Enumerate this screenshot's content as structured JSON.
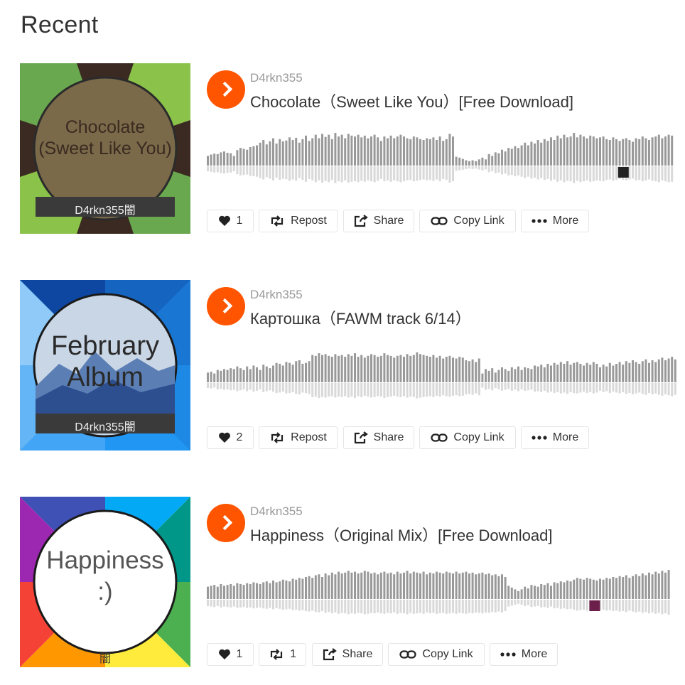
{
  "heading": "Recent",
  "colors": {
    "accent": "#ff5500",
    "wave": "#999999",
    "wave_reflection": "#d9d9d9"
  },
  "tracks": [
    {
      "artist": "D4rkn355",
      "title": "Chocolate（Sweet Like You）[Free Download]",
      "art": {
        "line1": "Chocolate",
        "line2": "(Sweet Like You)",
        "signature": "D4rkn355闇"
      },
      "actions": {
        "like_count": "1",
        "repost_label": "Repost",
        "share_label": "Share",
        "copy_link_label": "Copy Link",
        "more_label": "More"
      },
      "waveform": [
        0.22,
        0.25,
        0.27,
        0.26,
        0.3,
        0.32,
        0.29,
        0.28,
        0.22,
        0.35,
        0.4,
        0.38,
        0.36,
        0.42,
        0.44,
        0.46,
        0.52,
        0.58,
        0.48,
        0.55,
        0.62,
        0.5,
        0.6,
        0.55,
        0.57,
        0.64,
        0.58,
        0.63,
        0.52,
        0.6,
        0.68,
        0.56,
        0.62,
        0.7,
        0.62,
        0.72,
        0.65,
        0.7,
        0.6,
        0.74,
        0.66,
        0.7,
        0.62,
        0.72,
        0.68,
        0.66,
        0.7,
        0.64,
        0.68,
        0.62,
        0.66,
        0.7,
        0.64,
        0.56,
        0.66,
        0.62,
        0.68,
        0.62,
        0.66,
        0.7,
        0.66,
        0.62,
        0.6,
        0.66,
        0.64,
        0.6,
        0.58,
        0.62,
        0.6,
        0.64,
        0.58,
        0.66,
        0.56,
        0.6,
        0.72,
        0.66,
        0.2,
        0.18,
        0.15,
        0.12,
        0.1,
        0.12,
        0.1,
        0.14,
        0.18,
        0.14,
        0.26,
        0.22,
        0.3,
        0.28,
        0.36,
        0.32,
        0.4,
        0.38,
        0.44,
        0.4,
        0.46,
        0.52,
        0.46,
        0.54,
        0.5,
        0.58,
        0.52,
        0.6,
        0.56,
        0.64,
        0.58,
        0.68,
        0.62,
        0.7,
        0.64,
        0.66,
        0.74,
        0.64,
        0.7,
        0.66,
        0.62,
        0.68,
        0.66,
        0.62,
        0.64,
        0.66,
        0.6,
        0.58,
        0.64,
        0.6,
        0.56,
        0.6,
        0.62,
        0.58,
        0.54,
        0.62,
        0.6,
        0.66,
        0.62,
        0.58,
        0.64,
        0.66,
        0.7,
        0.62,
        0.66,
        0.7,
        0.68
      ],
      "thumb_color": "#222222",
      "thumb_at": 0.86
    },
    {
      "artist": "D4rkn355",
      "title": "Картошка（FAWM track 6/14）",
      "art": {
        "line1": "February",
        "line2": "Album",
        "signature": "D4rkn355闇"
      },
      "actions": {
        "like_count": "2",
        "repost_label": "Repost",
        "share_label": "Share",
        "copy_link_label": "Copy Link",
        "more_label": "More"
      },
      "waveform": [
        0.22,
        0.24,
        0.2,
        0.28,
        0.26,
        0.3,
        0.28,
        0.32,
        0.3,
        0.36,
        0.32,
        0.28,
        0.36,
        0.3,
        0.38,
        0.34,
        0.28,
        0.4,
        0.36,
        0.32,
        0.38,
        0.44,
        0.42,
        0.38,
        0.46,
        0.44,
        0.4,
        0.48,
        0.5,
        0.42,
        0.44,
        0.48,
        0.62,
        0.6,
        0.66,
        0.62,
        0.64,
        0.6,
        0.58,
        0.64,
        0.6,
        0.62,
        0.58,
        0.64,
        0.6,
        0.66,
        0.58,
        0.62,
        0.56,
        0.6,
        0.64,
        0.62,
        0.58,
        0.6,
        0.66,
        0.62,
        0.6,
        0.56,
        0.6,
        0.62,
        0.58,
        0.64,
        0.6,
        0.62,
        0.68,
        0.64,
        0.62,
        0.6,
        0.58,
        0.62,
        0.56,
        0.6,
        0.54,
        0.58,
        0.6,
        0.56,
        0.54,
        0.58,
        0.56,
        0.5,
        0.48,
        0.52,
        0.46,
        0.54,
        0.2,
        0.3,
        0.26,
        0.32,
        0.22,
        0.28,
        0.34,
        0.3,
        0.26,
        0.34,
        0.3,
        0.36,
        0.28,
        0.34,
        0.32,
        0.3,
        0.38,
        0.36,
        0.4,
        0.34,
        0.42,
        0.38,
        0.44,
        0.4,
        0.46,
        0.42,
        0.48,
        0.4,
        0.44,
        0.46,
        0.42,
        0.38,
        0.44,
        0.4,
        0.46,
        0.42,
        0.34,
        0.4,
        0.36,
        0.44,
        0.38,
        0.42,
        0.46,
        0.4,
        0.48,
        0.44,
        0.5,
        0.46,
        0.42,
        0.48,
        0.52,
        0.44,
        0.5,
        0.46,
        0.52,
        0.56,
        0.5,
        0.54,
        0.58,
        0.52
      ],
      "thumb_color": null,
      "thumb_at": null
    },
    {
      "artist": "D4rkn355",
      "title": "Happiness（Original Mix）[Free Download]",
      "art": {
        "line1": "Happiness",
        "line2": ":)",
        "signature": "闇"
      },
      "actions": {
        "like_count": "1",
        "repost_count": "1",
        "share_label": "Share",
        "copy_link_label": "Copy Link",
        "more_label": "More"
      },
      "waveform": [
        0.28,
        0.3,
        0.32,
        0.28,
        0.34,
        0.3,
        0.32,
        0.34,
        0.3,
        0.36,
        0.34,
        0.32,
        0.36,
        0.34,
        0.38,
        0.36,
        0.34,
        0.38,
        0.4,
        0.36,
        0.42,
        0.38,
        0.4,
        0.44,
        0.42,
        0.4,
        0.46,
        0.44,
        0.48,
        0.46,
        0.5,
        0.52,
        0.48,
        0.54,
        0.56,
        0.5,
        0.58,
        0.54,
        0.6,
        0.56,
        0.62,
        0.58,
        0.6,
        0.64,
        0.6,
        0.62,
        0.58,
        0.6,
        0.64,
        0.62,
        0.58,
        0.6,
        0.56,
        0.6,
        0.62,
        0.58,
        0.6,
        0.56,
        0.62,
        0.58,
        0.6,
        0.64,
        0.58,
        0.62,
        0.6,
        0.58,
        0.62,
        0.56,
        0.6,
        0.58,
        0.62,
        0.6,
        0.58,
        0.62,
        0.6,
        0.58,
        0.62,
        0.58,
        0.6,
        0.62,
        0.58,
        0.6,
        0.56,
        0.58,
        0.6,
        0.56,
        0.58,
        0.54,
        0.56,
        0.52,
        0.56,
        0.5,
        0.3,
        0.26,
        0.22,
        0.18,
        0.22,
        0.28,
        0.24,
        0.32,
        0.3,
        0.28,
        0.34,
        0.32,
        0.36,
        0.3,
        0.38,
        0.36,
        0.4,
        0.38,
        0.42,
        0.4,
        0.44,
        0.48,
        0.46,
        0.44,
        0.48,
        0.46,
        0.44,
        0.42,
        0.46,
        0.44,
        0.48,
        0.46,
        0.5,
        0.48,
        0.52,
        0.5,
        0.54,
        0.48,
        0.52,
        0.56,
        0.52,
        0.58,
        0.54,
        0.6,
        0.56,
        0.62,
        0.58,
        0.64,
        0.6,
        0.66
      ],
      "thumb_color": "#6b1f4a",
      "thumb_at": 0.8
    }
  ]
}
